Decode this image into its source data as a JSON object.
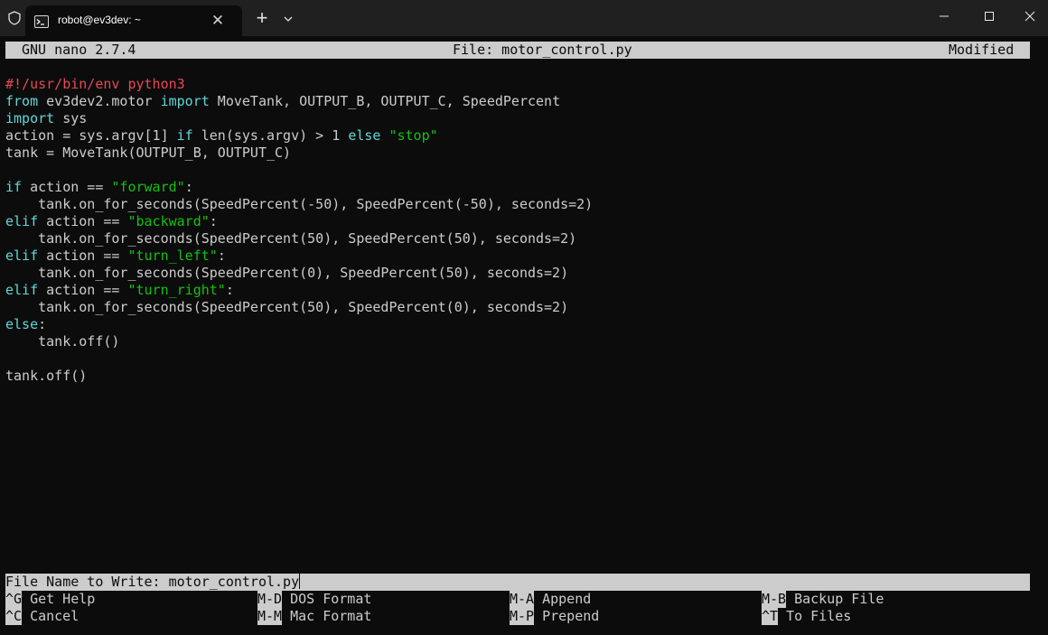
{
  "window": {
    "tab_title": "robot@ev3dev: ~",
    "tab_close_glyph": "✕",
    "new_tab_glyph": "+",
    "icons": {
      "shield": "shield-icon",
      "terminal": "terminal-icon",
      "dropdown": "chevron-down-icon",
      "minimize": "minimize-icon",
      "maximize": "maximize-icon",
      "close": "close-icon"
    },
    "colors": {
      "titlebar": "#202020",
      "terminal_bg": "#0c0c0c",
      "foreground": "#cccccc",
      "keyword": "#61d6d6",
      "string": "#13c10e",
      "shebang": "#e74856"
    }
  },
  "nano": {
    "version": "GNU nano 2.7.4",
    "filename": "File: motor_control.py",
    "status": "Modified"
  },
  "editor": {
    "lines": [
      [
        {
          "t": "#!/usr/bin/env python3",
          "c": "shebang"
        }
      ],
      [
        {
          "t": "from",
          "c": "kw"
        },
        {
          "t": " ev3dev2.motor ",
          "c": "plain"
        },
        {
          "t": "import",
          "c": "kw"
        },
        {
          "t": " MoveTank, OUTPUT_B, OUTPUT_C, SpeedPercent",
          "c": "plain"
        }
      ],
      [
        {
          "t": "import",
          "c": "kw"
        },
        {
          "t": " sys",
          "c": "plain"
        }
      ],
      [
        {
          "t": "action = sys.argv[1] ",
          "c": "plain"
        },
        {
          "t": "if",
          "c": "kw"
        },
        {
          "t": " len(sys.argv) > 1 ",
          "c": "plain"
        },
        {
          "t": "else",
          "c": "kw"
        },
        {
          "t": " ",
          "c": "plain"
        },
        {
          "t": "\"stop\"",
          "c": "str"
        }
      ],
      [
        {
          "t": "tank = MoveTank(OUTPUT_B, OUTPUT_C)",
          "c": "plain"
        }
      ],
      [],
      [
        {
          "t": "if",
          "c": "kw"
        },
        {
          "t": " action == ",
          "c": "plain"
        },
        {
          "t": "\"forward\"",
          "c": "str"
        },
        {
          "t": ":",
          "c": "plain"
        }
      ],
      [
        {
          "t": "    tank.on_for_seconds(SpeedPercent(-50), SpeedPercent(-50), seconds=2)",
          "c": "plain"
        }
      ],
      [
        {
          "t": "elif",
          "c": "kw"
        },
        {
          "t": " action == ",
          "c": "plain"
        },
        {
          "t": "\"backward\"",
          "c": "str"
        },
        {
          "t": ":",
          "c": "plain"
        }
      ],
      [
        {
          "t": "    tank.on_for_seconds(SpeedPercent(50), SpeedPercent(50), seconds=2)",
          "c": "plain"
        }
      ],
      [
        {
          "t": "elif",
          "c": "kw"
        },
        {
          "t": " action == ",
          "c": "plain"
        },
        {
          "t": "\"turn_left\"",
          "c": "str"
        },
        {
          "t": ":",
          "c": "plain"
        }
      ],
      [
        {
          "t": "    tank.on_for_seconds(SpeedPercent(0), SpeedPercent(50), seconds=2)",
          "c": "plain"
        }
      ],
      [
        {
          "t": "elif",
          "c": "kw"
        },
        {
          "t": " action == ",
          "c": "plain"
        },
        {
          "t": "\"turn_right\"",
          "c": "str"
        },
        {
          "t": ":",
          "c": "plain"
        }
      ],
      [
        {
          "t": "    tank.on_for_seconds(SpeedPercent(50), SpeedPercent(0), seconds=2)",
          "c": "plain"
        }
      ],
      [
        {
          "t": "else",
          "c": "kw"
        },
        {
          "t": ":",
          "c": "plain"
        }
      ],
      [
        {
          "t": "    tank.off()",
          "c": "plain"
        }
      ],
      [],
      [
        {
          "t": "tank.off()",
          "c": "plain"
        }
      ]
    ]
  },
  "prompt": {
    "text": "File Name to Write: motor_control.py"
  },
  "shortcuts": {
    "get_help": {
      "key": "^G",
      "label": "Get Help"
    },
    "cancel": {
      "key": "^C",
      "label": "Cancel"
    },
    "dos_format": {
      "key": "M-D",
      "label": "DOS Format"
    },
    "mac_format": {
      "key": "M-M",
      "label": "Mac Format"
    },
    "append": {
      "key": "M-A",
      "label": "Append"
    },
    "prepend": {
      "key": "M-P",
      "label": "Prepend"
    },
    "backup_file": {
      "key": "M-B",
      "label": "Backup File"
    },
    "to_files": {
      "key": "^T",
      "label": "To Files"
    }
  }
}
